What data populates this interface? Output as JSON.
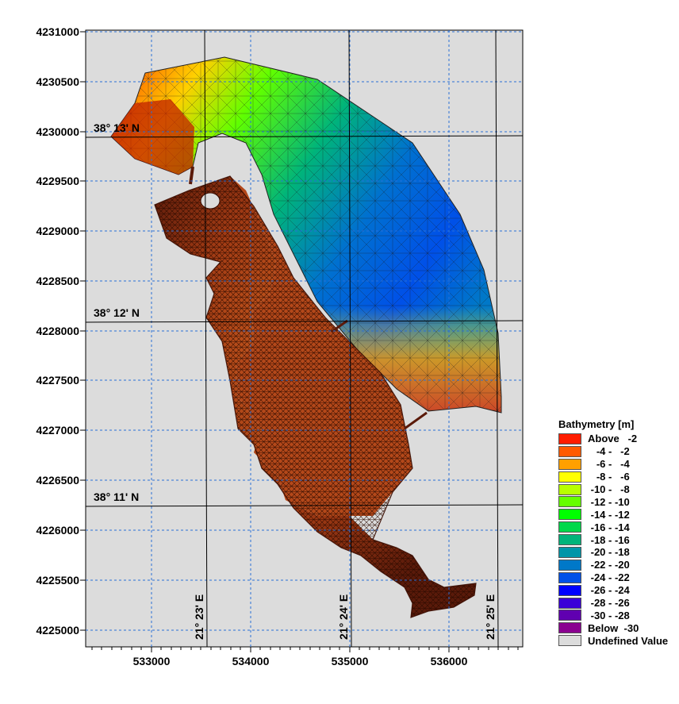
{
  "map": {
    "x_ticks": [
      "533000",
      "534000",
      "535000",
      "536000"
    ],
    "y_ticks": [
      "4231000",
      "4230500",
      "4230000",
      "4229500",
      "4229000",
      "4228500",
      "4228000",
      "4227500",
      "4227000",
      "4226500",
      "4226000",
      "4225500",
      "4225000"
    ],
    "lat_labels": [
      "38° 13' N",
      "38° 12' N",
      "38° 11' N"
    ],
    "lon_labels": [
      "21° 23' E",
      "21° 24' E",
      "21° 25' E"
    ],
    "background_color": "#dcdcdc",
    "grid_color": "#2a6fd6"
  },
  "legend": {
    "title": "Bathymetry [m]",
    "items": [
      {
        "label": "Above   -2",
        "color": "#ff1c00"
      },
      {
        "label": "   -4 -   -2",
        "color": "#ff5a00"
      },
      {
        "label": "   -6 -   -4",
        "color": "#ffa000"
      },
      {
        "label": "   -8 -   -6",
        "color": "#ffff00"
      },
      {
        "label": " -10 -   -8",
        "color": "#b8ff00"
      },
      {
        "label": " -12 - -10",
        "color": "#66ff00"
      },
      {
        "label": " -14 - -12",
        "color": "#00ff00"
      },
      {
        "label": " -16 - -14",
        "color": "#00d84a"
      },
      {
        "label": " -18 - -16",
        "color": "#00b47a"
      },
      {
        "label": " -20 - -18",
        "color": "#0096a8"
      },
      {
        "label": " -22 - -20",
        "color": "#0078c8"
      },
      {
        "label": " -24 - -22",
        "color": "#0050e8"
      },
      {
        "label": " -26 - -24",
        "color": "#0000ff"
      },
      {
        "label": " -28 - -26",
        "color": "#3a00d8"
      },
      {
        "label": " -30 - -28",
        "color": "#6000b0"
      },
      {
        "label": "Below  -30",
        "color": "#8a0090"
      },
      {
        "label": "Undefined Value",
        "color": "#dcdcdc"
      }
    ]
  }
}
